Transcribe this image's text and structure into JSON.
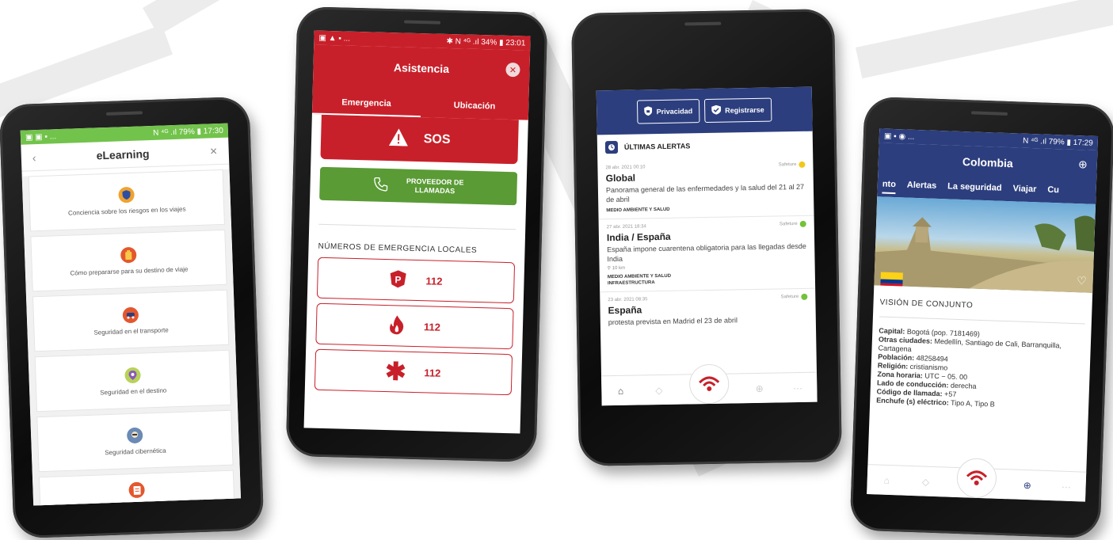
{
  "colors": {
    "elearning_green": "#72c34b",
    "assist_red": "#c8202a",
    "call_green": "#5a9b35",
    "navy": "#2c3e7e",
    "dot_yellow": "#f2c81b",
    "dot_green": "#74c13a"
  },
  "elearning": {
    "status_left": "▣ ▣ ▪ ...",
    "status_right": "N ⁴ᴳ .ıl 79% ▮ 17:30",
    "title": "eLearning",
    "items": [
      {
        "label": "Conciencia sobre los riesgos en los viajes",
        "icon": "shield-icon",
        "color": "#f0a22e"
      },
      {
        "label": "Cómo prepararse para su destino de viaje",
        "icon": "luggage-icon",
        "color": "#e4572e"
      },
      {
        "label": "Seguridad en el transporte",
        "icon": "transport-icon",
        "color": "#e4572e"
      },
      {
        "label": "Seguridad en el destino",
        "icon": "location-pin-icon",
        "color": "#b8d25a"
      },
      {
        "label": "Seguridad cibernética",
        "icon": "hacker-icon",
        "color": "#6b8ab5"
      },
      {
        "label": "",
        "icon": "document-icon",
        "color": "#e4572e"
      }
    ]
  },
  "asistencia": {
    "status_left": "▣ ▲ ▪ ...",
    "status_right": "✱ N ⁴ᴳ .ıl 34% ▮ 23:01",
    "title": "Asistencia",
    "tabs": [
      "Emergencia",
      "Ubicación"
    ],
    "sos_label": "SOS",
    "call_label_1": "PROVEEDOR DE",
    "call_label_2": "LLAMADAS",
    "section": "NÚMEROS DE EMERGENCIA LOCALES",
    "numbers": [
      {
        "type": "police",
        "number": "112"
      },
      {
        "type": "fire",
        "number": "112"
      },
      {
        "type": "medical",
        "number": "112"
      }
    ]
  },
  "alertas": {
    "privacy_label": "Privacidad",
    "register_label": "Registrarse",
    "heading": "ÚLTIMAS ALERTAS",
    "items": [
      {
        "date": "28 abr. 2021 00:10",
        "source": "Safeture",
        "dot": "yellow",
        "title": "Global",
        "desc": "Panorama general de las enfermedades y la salud del 21 al 27 de abril",
        "distance": "",
        "tags": [
          "MEDIO AMBIENTE Y SALUD"
        ]
      },
      {
        "date": "27 abr. 2021 18:34",
        "source": "Safeture",
        "dot": "green",
        "title": "India / España",
        "desc": "España impone cuarentena obligatoria para las llegadas desde India",
        "distance": "10 km",
        "tags": [
          "MEDIO AMBIENTE Y SALUD",
          "INFRAESTRUCTURA"
        ]
      },
      {
        "date": "23 abr. 2021 08:35",
        "source": "Safeture",
        "dot": "green",
        "title": "España",
        "desc": "protesta prevista en Madrid el 23 de abril",
        "distance": "",
        "tags": []
      }
    ]
  },
  "colombia": {
    "status_left": "▣ ▪ ◉ ...",
    "status_right": "N ⁴ᴳ .ıl 79% ▮ 17:29",
    "title": "Colombia",
    "tabs": [
      "nto",
      "Alertas",
      "La seguridad",
      "Viajar",
      "Cu"
    ],
    "section": "VISIÓN DE CONJUNTO",
    "info": [
      {
        "key": "Capital:",
        "value": " Bogotá (pop. 7181469)"
      },
      {
        "key": "Otras ciudades:",
        "value": " Medellín, Santiago de Cali, Barranquilla, Cartagena"
      },
      {
        "key": "Población:",
        "value": " 48258494"
      },
      {
        "key": "Religión:",
        "value": " cristianismo"
      },
      {
        "key": "Zona horaria:",
        "value": " UTC − 05. 00"
      },
      {
        "key": "Lado de conducción:",
        "value": " derecha"
      },
      {
        "key": "Código de llamada:",
        "value": " +57"
      },
      {
        "key": "Enchufe (s) eléctrico:",
        "value": " Tipo A, Tipo B"
      }
    ]
  }
}
